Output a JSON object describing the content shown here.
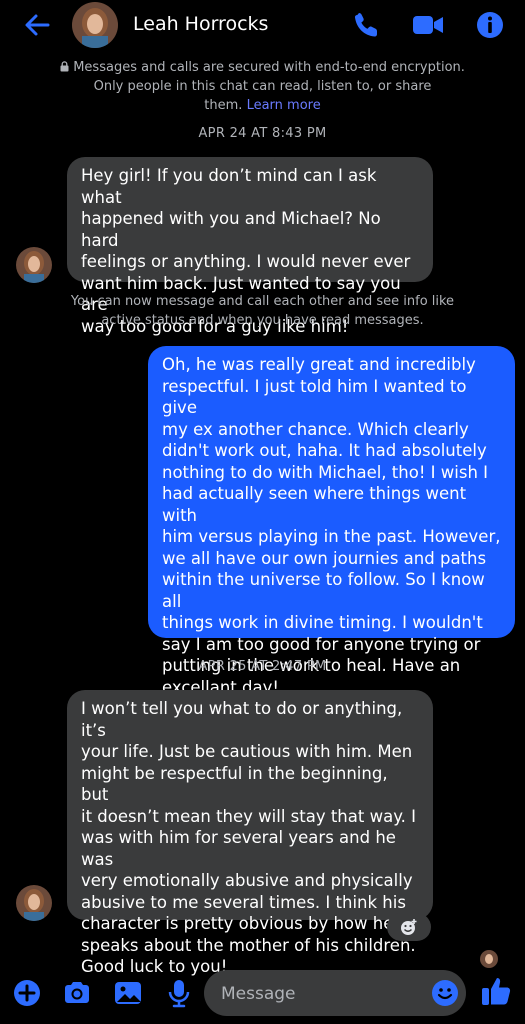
{
  "header": {
    "contact_name": "Leah Horrocks",
    "accent_color": "#2d6cff"
  },
  "encryption": {
    "line1": "Messages and calls are secured with end-to-end encryption.",
    "line2": "Only people in this chat can read, listen to, or share",
    "line3": "them.",
    "learn_more": "Learn more"
  },
  "messages": [
    {
      "type": "timestamp",
      "text": "APR 24 AT 8:43 PM"
    },
    {
      "type": "received",
      "lines": [
        "Hey girl! If you don’t mind can I ask what",
        "happened with you and Michael? No hard",
        "feelings or anything. I would never ever",
        "want him back. Just wanted to say you are",
        "way too good for a guy like him!"
      ]
    },
    {
      "type": "info",
      "lines": [
        "You can now message and call each other and see info like",
        "active status and when you have read messages."
      ]
    },
    {
      "type": "sent",
      "lines": [
        "Oh, he was really great and incredibly",
        "respectful. I just told him I wanted to give",
        "my ex another chance. Which clearly",
        "didn't work out, haha. It had absolutely",
        "nothing to do with Michael, tho! I wish I",
        "had actually seen where things went with",
        "him versus playing in the past. However,",
        "we all have our own journies and paths",
        "within the universe to follow. So I know all",
        "things work in divine timing. I wouldn't",
        "say I am too good for anyone trying or",
        "putting in the work to heal. Have an",
        "excellant day!"
      ]
    },
    {
      "type": "timestamp",
      "text": "APR 25 AT 2:47 PM"
    },
    {
      "type": "received",
      "lines": [
        "I won’t tell you what to do or anything, it’s",
        "your life. Just be cautious with him. Men",
        "might be respectful in the beginning, but",
        "it doesn’t mean they will stay that way. I",
        "was with him for several years and he was",
        "very emotionally abusive and physically",
        "abusive to me several times. I think his",
        "character is pretty obvious by how he",
        "speaks about the mother of his children.",
        "Good luck to you!"
      ]
    }
  ],
  "composer": {
    "placeholder": "Message"
  }
}
